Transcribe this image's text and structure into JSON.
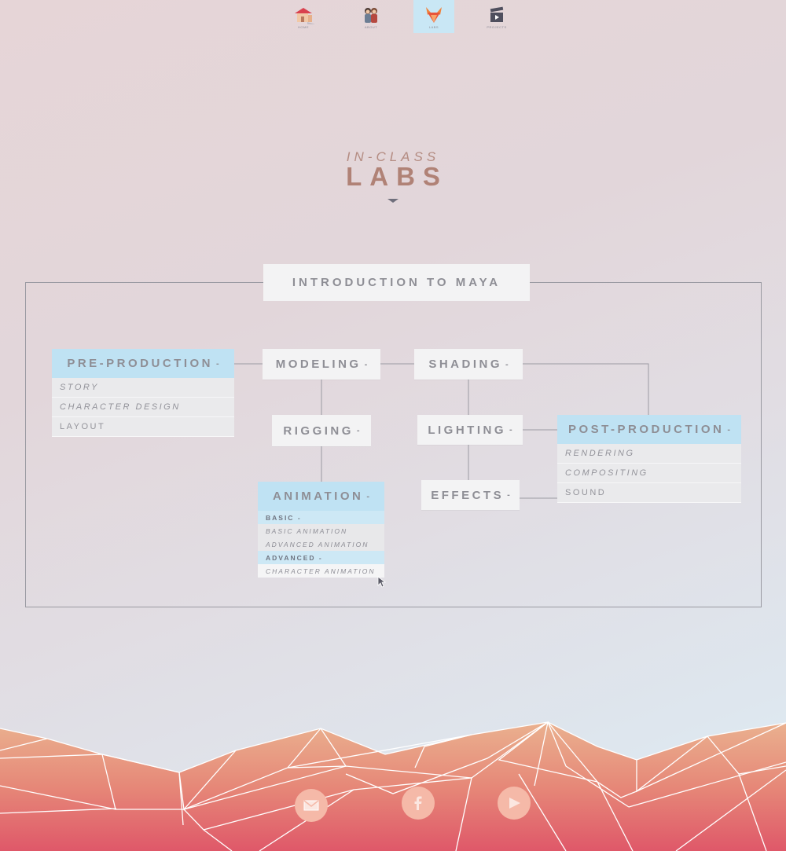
{
  "nav": {
    "items": [
      {
        "label": "HOME",
        "icon": "house-icon",
        "active": false
      },
      {
        "label": "ABOUT",
        "icon": "couple-icon",
        "active": false
      },
      {
        "label": "LABS",
        "icon": "fox-icon",
        "active": true
      },
      {
        "label": "PROJECTS",
        "icon": "video-clapper-icon",
        "active": false
      }
    ]
  },
  "heading": {
    "sub": "IN-CLASS",
    "main": "LABS"
  },
  "map": {
    "title": "INTRODUCTION TO MAYA",
    "pre_production": {
      "label": "PRE-PRODUCTION",
      "items": [
        "STORY",
        "CHARACTER DESIGN",
        "LAYOUT"
      ]
    },
    "modeling": {
      "label": "MODELING"
    },
    "shading": {
      "label": "SHADING"
    },
    "rigging": {
      "label": "RIGGING"
    },
    "lighting": {
      "label": "LIGHTING"
    },
    "effects": {
      "label": "EFFECTS"
    },
    "animation": {
      "label": "ANIMATION",
      "basic_label": "BASIC",
      "basic_items": [
        "BASIC ANIMATION",
        "ADVANCED ANIMATION"
      ],
      "advanced_label": "ADVANCED",
      "advanced_items": [
        "CHARACTER ANIMATION"
      ]
    },
    "post_production": {
      "label": "POST-PRODUCTION",
      "items": [
        "RENDERING",
        "COMPOSITING",
        "SOUND"
      ]
    },
    "dash": "-"
  },
  "footer": {
    "social": [
      "mail-icon",
      "facebook-icon",
      "youtube-icon"
    ]
  },
  "colors": {
    "active_nav": "#c9e7f5",
    "highlight": "#bfe2f3",
    "heading": "#b08276",
    "mountain_top": "#e9b08e",
    "mountain_bottom": "#e05a6a"
  }
}
